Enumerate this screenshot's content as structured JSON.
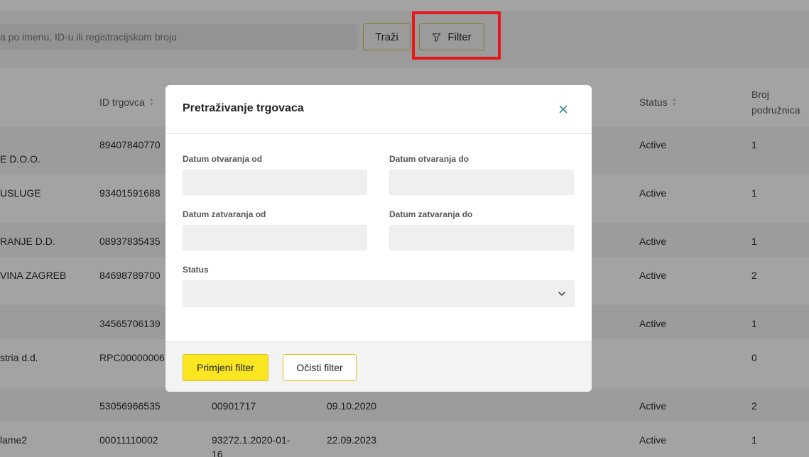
{
  "search": {
    "placeholder": "a po imenu, ID-u ili registracijskom broju",
    "search_button": "Traži",
    "filter_button": "Filter"
  },
  "table": {
    "headers": {
      "id": "ID trgovca",
      "status": "Status",
      "broj_line1": "Broj",
      "broj_line2": "podružnica"
    },
    "rows": [
      {
        "name": "E D.O.O.",
        "id": "89407840770",
        "col3": "",
        "col4": "",
        "status": "Active",
        "broj": "1"
      },
      {
        "name": "USLUGE",
        "id": "93401591688",
        "col3": "",
        "col4": "",
        "status": "Active",
        "broj": "1"
      },
      {
        "name": "RANJE D.D.",
        "id": "08937835435",
        "col3": "",
        "col4": "",
        "status": "Active",
        "broj": "1"
      },
      {
        "name": "VINA ZAGREB",
        "id": "84698789700",
        "col3": "",
        "col4": "",
        "status": "Active",
        "broj": "2"
      },
      {
        "name": "",
        "id": "34565706139",
        "col3": "",
        "col4": "",
        "status": "Active",
        "broj": "1"
      },
      {
        "name": "stria d.d.",
        "id": "RPC00000006",
        "col3": "",
        "col4": "",
        "status": "",
        "broj": "0"
      },
      {
        "name": "",
        "id": "53056966535",
        "col3": "00901717",
        "col4": "09.10.2020",
        "status": "Active",
        "broj": "2"
      },
      {
        "name": "lame2",
        "id": "00011110002",
        "col3": "93272.1.2020-01-16",
        "col4": "22.09.2023",
        "status": "Active",
        "broj": "1"
      }
    ]
  },
  "modal": {
    "title": "Pretraživanje trgovaca",
    "labels": {
      "open_from": "Datum otvaranja od",
      "open_to": "Datum otvaranja do",
      "close_from": "Datum zatvaranja od",
      "close_to": "Datum zatvaranja do",
      "status": "Status"
    },
    "apply_button": "Primjeni filter",
    "clear_button": "Očisti filter"
  },
  "colors": {
    "accent_yellow": "#fbe622",
    "button_border": "#d4bd2c",
    "highlight_red": "#e8151b",
    "close_icon": "#1a7a8a"
  },
  "icons": [
    "filter-icon",
    "sort-icon",
    "close-icon",
    "chevron-down-icon"
  ]
}
